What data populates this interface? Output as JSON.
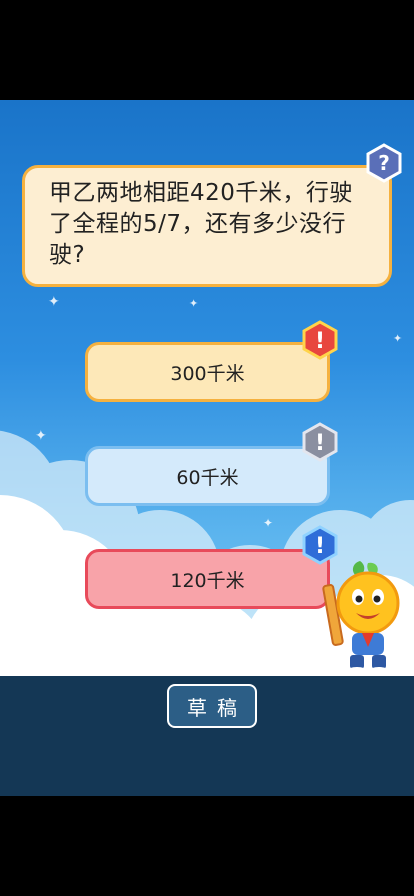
{
  "question": {
    "text": "甲乙两地相距420千米，行驶了全程的5/7，还有多少没行驶?"
  },
  "options": [
    {
      "label": "300千米"
    },
    {
      "label": "60千米"
    },
    {
      "label": "120千米"
    }
  ],
  "draft_button": {
    "label": "草稿"
  },
  "badges": {
    "question": "?",
    "option": "!"
  },
  "colors": {
    "sky_top": "#1a74c9",
    "question_fill": "#fdeed2",
    "orange_border": "#f5b13f",
    "blue_option": "#d4eafb",
    "red_option": "#f8a3a9",
    "bottom_bar": "#143755"
  },
  "icons": [
    "help-question-icon",
    "hint-exclamation-icon",
    "sparkle-icon",
    "cloud",
    "orange-mascot"
  ]
}
